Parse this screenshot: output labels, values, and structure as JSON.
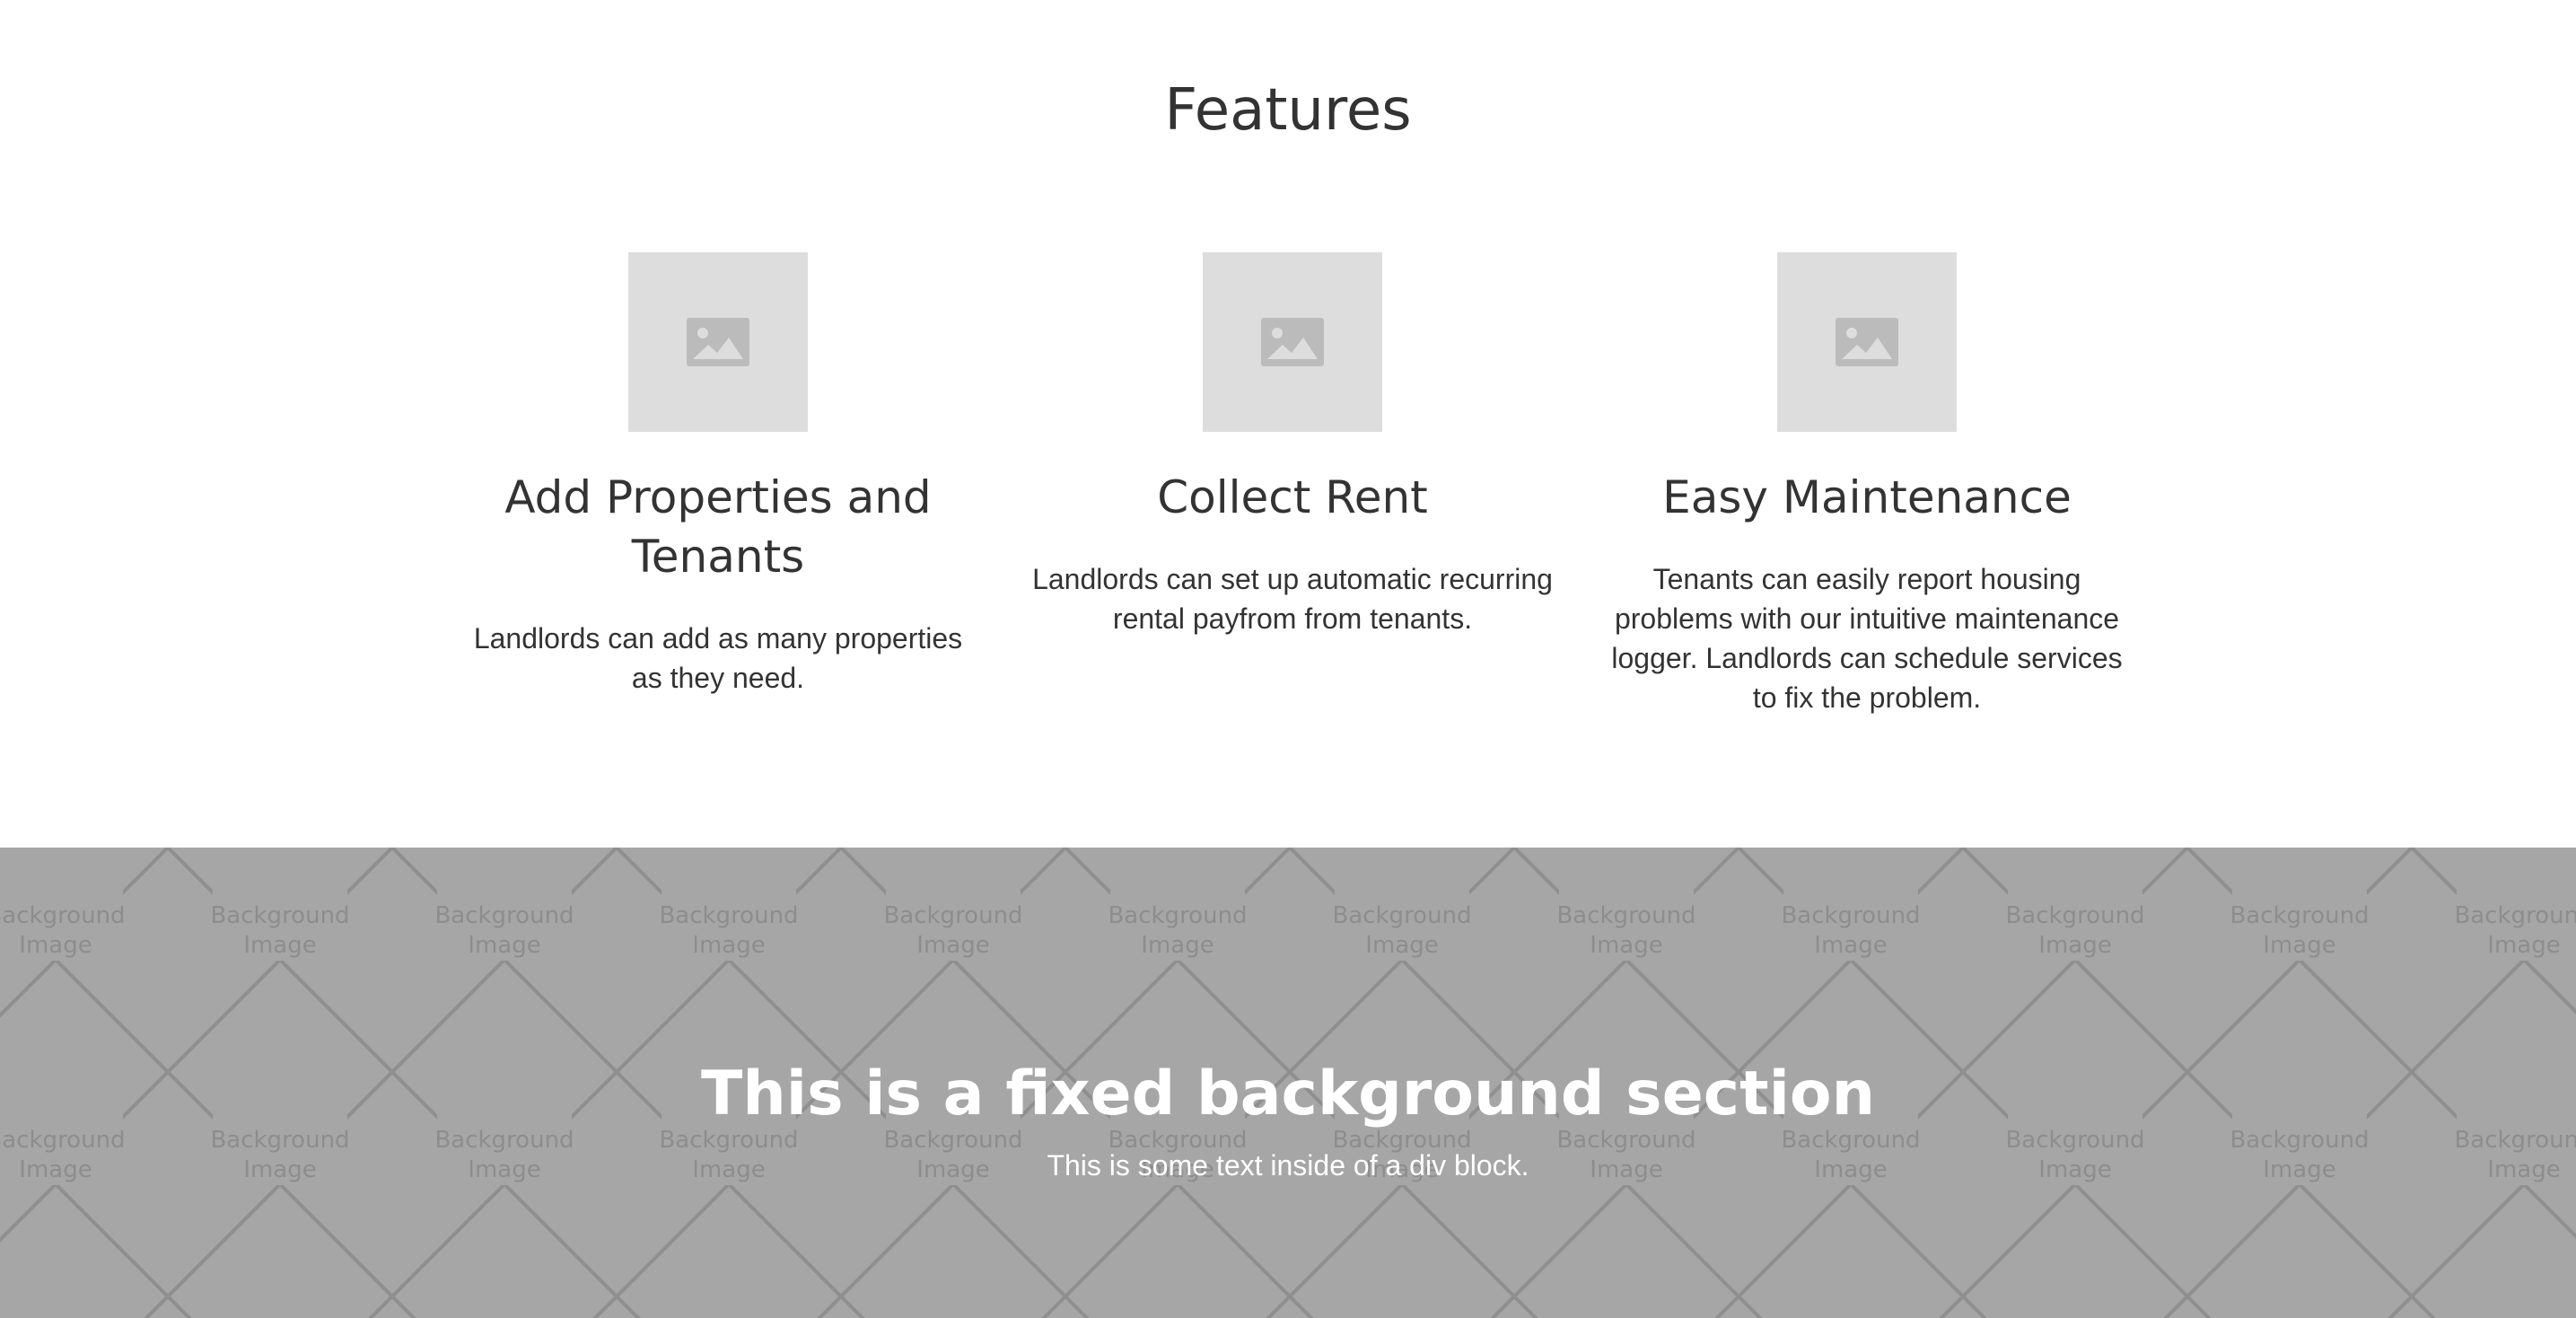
{
  "features_section": {
    "title": "Features",
    "items": [
      {
        "image_icon": "image-placeholder-icon",
        "title": "Add Properties and Tenants",
        "text": "Landlords can add as many properties as they need."
      },
      {
        "image_icon": "image-placeholder-icon",
        "title": "Collect Rent",
        "text": "Landlords can set up automatic recurring rental payfrom from tenants."
      },
      {
        "image_icon": "image-placeholder-icon",
        "title": "Easy Maintenance",
        "text": "Tenants can easily report housing problems with our intuitive maintenance logger. Landlords can schedule services to fix the problem."
      }
    ]
  },
  "background_section": {
    "pattern_label": "Background Image",
    "heading": "This is a fixed background section",
    "text": "This is some text inside of a div block."
  },
  "colors": {
    "text": "#333333",
    "placeholder_bg": "#dddddd",
    "placeholder_icon": "#bbbbbb",
    "section_bg": "#a6a6a6",
    "section_text": "#ffffff"
  }
}
